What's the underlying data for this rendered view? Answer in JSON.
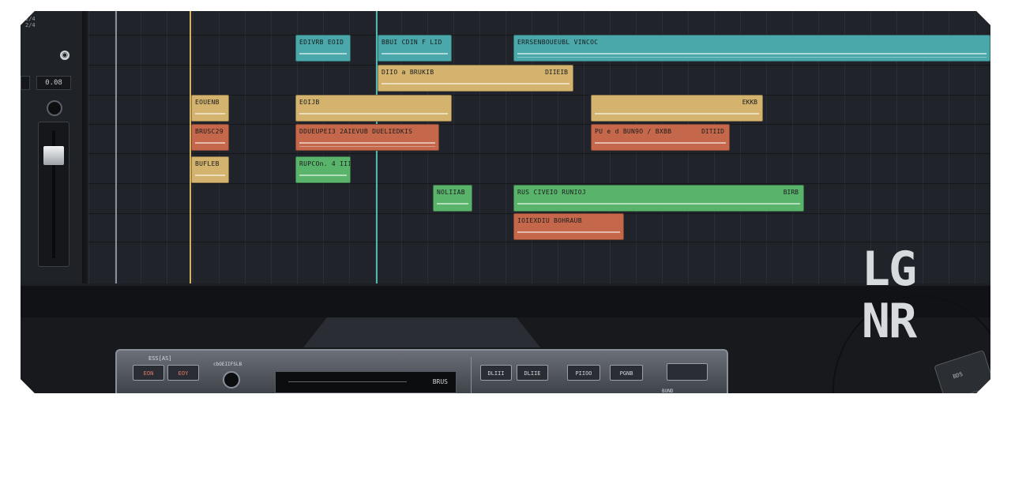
{
  "left_panel": {
    "top_text_a": "2/4",
    "top_text_b": "2/4",
    "value_field": "0.08",
    "icons": [
      "camera-icon",
      "knob",
      "fader"
    ]
  },
  "arrangement": {
    "regions": [
      {
        "label": "EDIVRB EOID",
        "label2": "",
        "color": "teal"
      },
      {
        "label": "BBUI CDIN F LID",
        "label2": "",
        "color": "teal"
      },
      {
        "label": "ERRSENBOUEUBL VINCOC",
        "label2": "",
        "color": "teal"
      },
      {
        "label": "DIIO a BRUKIB",
        "label2": "DIIEIB",
        "color": "tan"
      },
      {
        "label": "EOIJB",
        "label2": "",
        "color": "tan"
      },
      {
        "label": "EOUENB",
        "label2": "",
        "color": "tan"
      },
      {
        "label": "",
        "label2": "EKKB",
        "color": "tan"
      },
      {
        "label": "BRUSC29",
        "label2": "",
        "color": "orange"
      },
      {
        "label": "DDUEUPEI3 2AIEVUB DUELIEDKIS",
        "label2": "",
        "color": "orange"
      },
      {
        "label": "PU e d BUN9O / BXBB",
        "label2": "DITIID",
        "color": "orange"
      },
      {
        "label": "BUFLEB",
        "label2": "",
        "color": "tan"
      },
      {
        "label": "RUPCOn. 4 IIIl",
        "label2": "",
        "color": "green"
      },
      {
        "label": "NOLIIAB",
        "label2": "",
        "color": "green"
      },
      {
        "label": "RUS CIVEIO RUNIOJ",
        "label2": "BIRB",
        "color": "green"
      },
      {
        "label": "IOIEXDIU BOHRAUB",
        "label2": "",
        "color": "orange"
      }
    ]
  },
  "deck": {
    "label": "ESS[AS]",
    "btn_a": "EON",
    "btn_b": "EOY",
    "knob_label": "cbOEIIFSLB",
    "screen_text": "BRUS",
    "btn_1": "DLIII",
    "btn_2": "DLIIE",
    "btn_3": "PIIOO",
    "btn_4": "PGNB",
    "btn_5": "",
    "rec_label": "BUND"
  },
  "logo": {
    "line1": "LG",
    "line2": "NR"
  },
  "corner_device": {
    "text": "BDS"
  },
  "colors": {
    "background": "#1c1f24",
    "teal": "#4aa8aa",
    "tan": "#d3b36d",
    "orange": "#c4674a",
    "green": "#5ab36a",
    "playhead": "#4fb9b0",
    "marker": "#d4b25c"
  }
}
